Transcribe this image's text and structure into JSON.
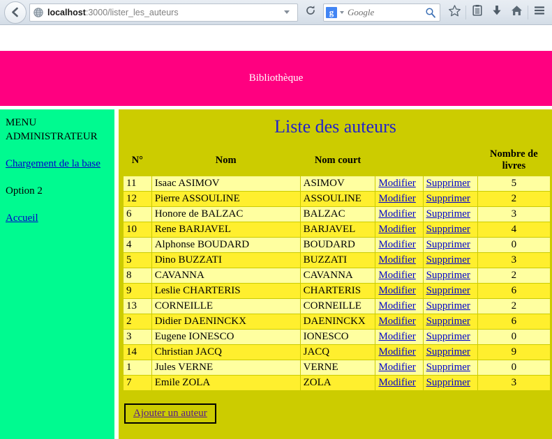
{
  "browser": {
    "back_icon": "back-arrow-icon",
    "url_host": "localhost",
    "url_path": ":3000/lister_les_auteurs",
    "url_full": "localhost:3000/lister_les_auteurs",
    "globe_icon": "globe-icon",
    "dropdown_icon": "chevron-down-icon",
    "reload_icon": "reload-icon",
    "search_engine_badge": "g",
    "search_engine_name": "Google",
    "search_placeholder": "Google",
    "search_icon": "magnifier-icon",
    "toolbar_icons": [
      "star-icon",
      "library-icon",
      "download-icon",
      "home-icon",
      "hamburger-menu-icon"
    ]
  },
  "site": {
    "header_title": "Bibliothèque",
    "header_bg": "#ff0080",
    "sidebar_bg": "#00fa90",
    "main_bg": "#cccc00",
    "title_color": "#2222cc"
  },
  "sidebar": {
    "menu_title_line1": "MENU",
    "menu_title_line2": "ADMINISTRATEUR",
    "items": [
      {
        "label": "Chargement de la base",
        "is_link": true
      },
      {
        "label": "Option 2",
        "is_link": false
      },
      {
        "label": "Accueil",
        "is_link": true
      }
    ]
  },
  "main": {
    "page_title": "Liste des auteurs",
    "columns": [
      "N°",
      "Nom",
      "Nom court",
      "",
      "",
      "Nombre de livres"
    ],
    "action_edit": "Modifier",
    "action_delete": "Supprimer",
    "add_button_label": "Ajouter un auteur",
    "rows": [
      {
        "num": "11",
        "name": "Isaac ASIMOV",
        "short": "ASIMOV",
        "count": "5"
      },
      {
        "num": "12",
        "name": "Pierre ASSOULINE",
        "short": "ASSOULINE",
        "count": "2"
      },
      {
        "num": "6",
        "name": "Honore de BALZAC",
        "short": "BALZAC",
        "count": "3"
      },
      {
        "num": "10",
        "name": "Rene BARJAVEL",
        "short": "BARJAVEL",
        "count": "4"
      },
      {
        "num": "4",
        "name": "Alphonse BOUDARD",
        "short": "BOUDARD",
        "count": "0"
      },
      {
        "num": "5",
        "name": "Dino BUZZATI",
        "short": "BUZZATI",
        "count": "3"
      },
      {
        "num": "8",
        "name": "CAVANNA",
        "short": "CAVANNA",
        "count": "2"
      },
      {
        "num": "9",
        "name": "Leslie CHARTERIS",
        "short": "CHARTERIS",
        "count": "6"
      },
      {
        "num": "13",
        "name": "CORNEILLE",
        "short": "CORNEILLE",
        "count": "2"
      },
      {
        "num": "2",
        "name": "Didier DAENINCKX",
        "short": "DAENINCKX",
        "count": "6"
      },
      {
        "num": "3",
        "name": "Eugene IONESCO",
        "short": "IONESCO",
        "count": "0"
      },
      {
        "num": "14",
        "name": "Christian JACQ",
        "short": "JACQ",
        "count": "9"
      },
      {
        "num": "1",
        "name": "Jules VERNE",
        "short": "VERNE",
        "count": "0"
      },
      {
        "num": "7",
        "name": "Emile ZOLA",
        "short": "ZOLA",
        "count": "3"
      }
    ]
  }
}
